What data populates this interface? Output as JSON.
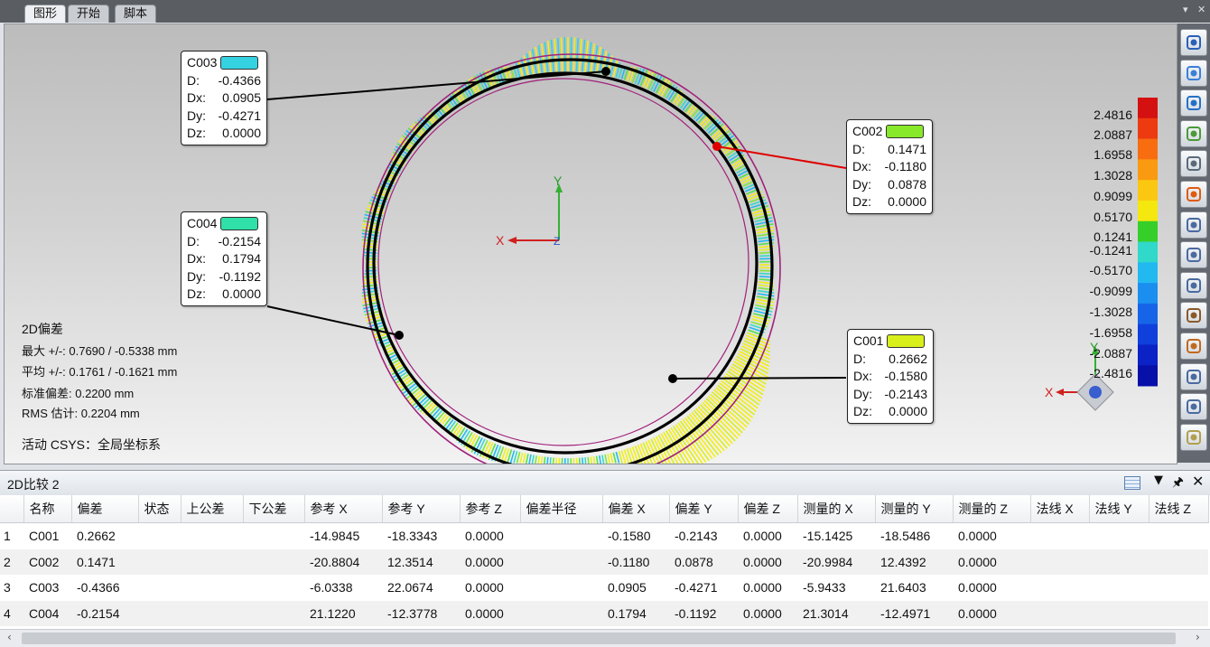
{
  "tabs": [
    "图形",
    "开始",
    "脚本"
  ],
  "active_tab_index": 0,
  "callouts": [
    {
      "id": "C003",
      "color": "#35d2e2",
      "rows": [
        [
          "D:",
          "-0.4366"
        ],
        [
          "Dx:",
          "0.0905"
        ],
        [
          "Dy:",
          "-0.4271"
        ],
        [
          "Dz:",
          "0.0000"
        ]
      ]
    },
    {
      "id": "C002",
      "color": "#88e82a",
      "rows": [
        [
          "D:",
          "0.1471"
        ],
        [
          "Dx:",
          "-0.1180"
        ],
        [
          "Dy:",
          "0.0878"
        ],
        [
          "Dz:",
          "0.0000"
        ]
      ]
    },
    {
      "id": "C004",
      "color": "#2fe0a8",
      "rows": [
        [
          "D:",
          "-0.2154"
        ],
        [
          "Dx:",
          "0.1794"
        ],
        [
          "Dy:",
          "-0.1192"
        ],
        [
          "Dz:",
          "0.0000"
        ]
      ]
    },
    {
      "id": "C001",
      "color": "#d8ef1a",
      "rows": [
        [
          "D:",
          "0.2662"
        ],
        [
          "Dx:",
          "-0.1580"
        ],
        [
          "Dy:",
          "-0.2143"
        ],
        [
          "Dz:",
          "0.0000"
        ]
      ]
    }
  ],
  "axes": {
    "x": "X",
    "y": "Y",
    "z": "Z"
  },
  "stats": {
    "title": "2D偏差",
    "max": "最大 +/-: 0.7690 / -0.5338 mm",
    "avg": "平均 +/-: 0.1761 / -0.1621 mm",
    "std": "标准偏差: 0.2200 mm",
    "rms": "RMS 估计: 0.2204 mm",
    "csys": "活动 CSYS：全局坐标系"
  },
  "legend": {
    "labels": [
      "2.4816",
      "2.0887",
      "1.6958",
      "1.3028",
      "0.9099",
      "0.5170",
      "0.1241",
      "-0.1241",
      "-0.5170",
      "-0.9099",
      "-1.3028",
      "-1.6958",
      "-2.0887",
      "-2.4816"
    ],
    "colors": [
      "#d51010",
      "#ee3a10",
      "#f76d10",
      "#f99a10",
      "#fbc710",
      "#f5e80f",
      "#36cf2a",
      "#30d9c9",
      "#22b9f1",
      "#1b8ff0",
      "#1665e8",
      "#1040db",
      "#0b22c6",
      "#0710a8"
    ]
  },
  "panel": {
    "title": "2D比较 2"
  },
  "table": {
    "columns": [
      "名称",
      "偏差",
      "状态",
      "上公差",
      "下公差",
      "参考 X",
      "参考 Y",
      "参考 Z",
      "偏差半径",
      "偏差 X",
      "偏差 Y",
      "偏差 Z",
      "测量的 X",
      "测量的 Y",
      "测量的 Z",
      "法线 X",
      "法线 Y",
      "法线 Z"
    ],
    "rows": [
      [
        "1",
        "C001",
        "0.2662",
        "",
        "",
        "",
        "-14.9845",
        "-18.3343",
        "0.0000",
        "",
        "-0.1580",
        "-0.2143",
        "0.0000",
        "-15.1425",
        "-18.5486",
        "0.0000",
        "",
        "",
        ""
      ],
      [
        "2",
        "C002",
        "0.1471",
        "",
        "",
        "",
        "-20.8804",
        "12.3514",
        "0.0000",
        "",
        "-0.1180",
        "0.0878",
        "0.0000",
        "-20.9984",
        "12.4392",
        "0.0000",
        "",
        "",
        ""
      ],
      [
        "3",
        "C003",
        "-0.4366",
        "",
        "",
        "",
        "-6.0338",
        "22.0674",
        "0.0000",
        "",
        "0.0905",
        "-0.4271",
        "0.0000",
        "-5.9433",
        "21.6403",
        "0.0000",
        "",
        "",
        ""
      ],
      [
        "4",
        "C004",
        "-0.2154",
        "",
        "",
        "",
        "21.1220",
        "-12.3778",
        "0.0000",
        "",
        "0.1794",
        "-0.1192",
        "0.0000",
        "21.3014",
        "-12.4971",
        "0.0000",
        "",
        "",
        ""
      ]
    ]
  },
  "toolbar_icons": [
    "views-icon",
    "rotate-icon",
    "display-icon",
    "mesh-icon",
    "zoom-icon",
    "color-icon",
    "box-select-icon",
    "lasso-select-icon",
    "line-select-icon",
    "brush-select-icon",
    "paint-icon",
    "polygon-select-icon",
    "polyline-select-icon",
    "layer-icon"
  ]
}
